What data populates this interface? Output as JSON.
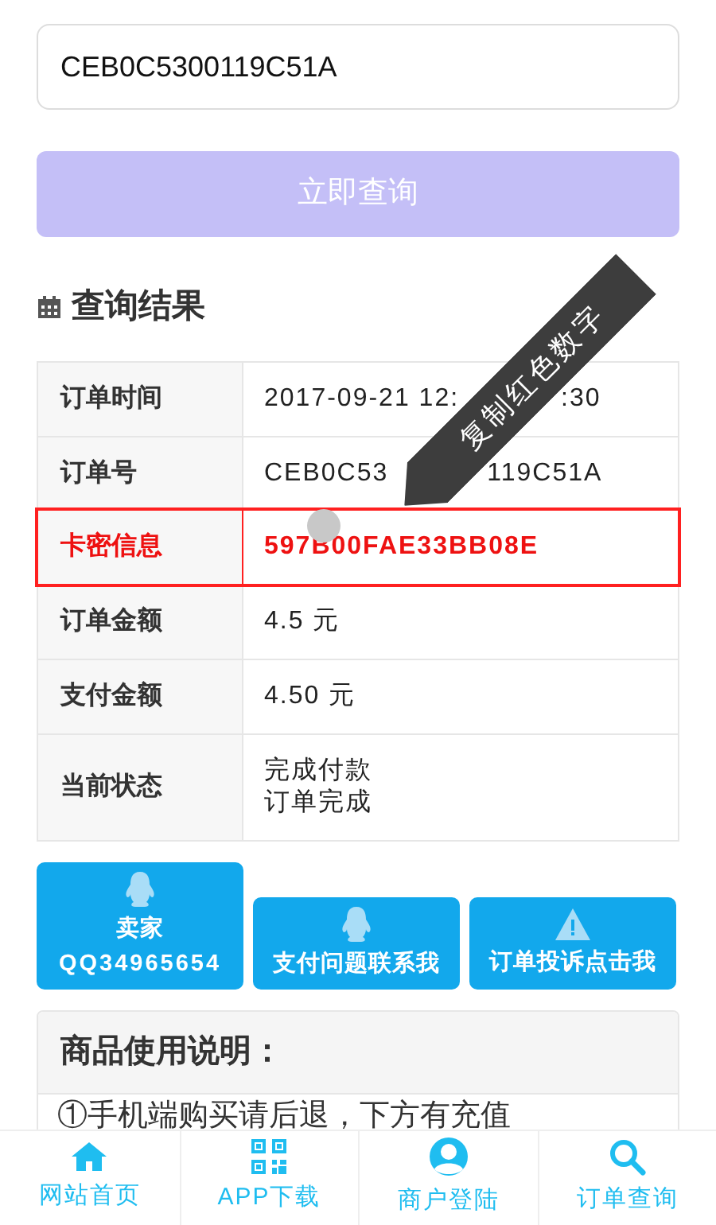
{
  "search": {
    "value": "CEB0C5300119C51A",
    "button": "立即查询",
    "disabled": true
  },
  "results": {
    "title": "查询结果",
    "rows": [
      {
        "label": "订单时间",
        "value_parts": [
          "2017-09-21 12:",
          ":30"
        ],
        "highlighted": false
      },
      {
        "label": "订单号",
        "value_parts": [
          "CEB0C53",
          "119C51A"
        ],
        "highlighted": false
      },
      {
        "label": "卡密信息",
        "value_parts": [
          "597B00FAE33BB08E"
        ],
        "highlighted": true
      },
      {
        "label": "订单金额",
        "value_parts": [
          "4.5 元"
        ],
        "highlighted": false
      },
      {
        "label": "支付金额",
        "value_parts": [
          "4.50 元"
        ],
        "highlighted": false
      },
      {
        "label": "当前状态",
        "value_lines": [
          "完成付款",
          "订单完成"
        ],
        "highlighted": false
      }
    ]
  },
  "tooltip": "复制红色数字",
  "contact_buttons": [
    {
      "kind": "qq",
      "lines": [
        "卖家",
        "QQ34965654"
      ]
    },
    {
      "kind": "qq",
      "lines": [
        "支付问题联系我"
      ]
    },
    {
      "kind": "warning",
      "lines": [
        "订单投诉点击我"
      ]
    }
  ],
  "instructions": {
    "title": "商品使用说明：",
    "text": "①手机端购买请后退，下方有充值"
  },
  "bottom_nav": [
    {
      "kind": "home",
      "label": "网站首页"
    },
    {
      "kind": "qr",
      "label": "APP下载"
    },
    {
      "kind": "user",
      "label": "商户登陆"
    },
    {
      "kind": "search",
      "label": "订单查询"
    }
  ]
}
